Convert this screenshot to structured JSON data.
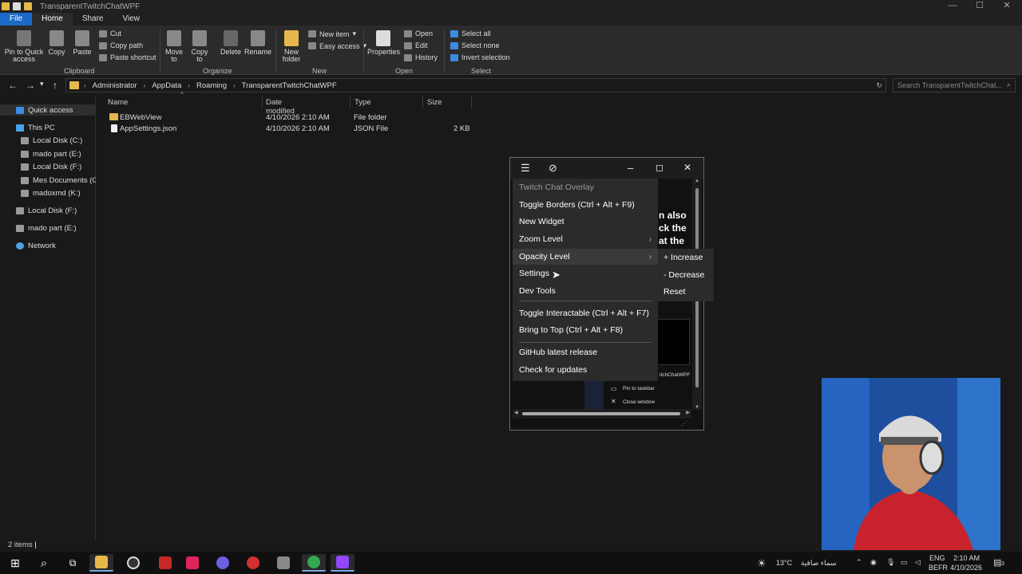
{
  "window": {
    "title": "TransparentTwitchChatWPF"
  },
  "ribbon": {
    "tabs": [
      "File",
      "Home",
      "Share",
      "View"
    ],
    "clipboard": {
      "pin": "Pin to Quick access",
      "copy": "Copy",
      "paste": "Paste",
      "cut": "Cut",
      "copy_path": "Copy path",
      "paste_shortcut": "Paste shortcut",
      "label": "Clipboard"
    },
    "organize": {
      "move_to": "Move to",
      "copy_to": "Copy to",
      "delete": "Delete",
      "rename": "Rename",
      "label": "Organize"
    },
    "new": {
      "new_folder": "New folder",
      "new_item": "New item",
      "easy_access": "Easy access",
      "label": "New"
    },
    "open": {
      "properties": "Properties",
      "open": "Open",
      "edit": "Edit",
      "history": "History",
      "label": "Open"
    },
    "select": {
      "select_all": "Select all",
      "select_none": "Select none",
      "invert": "Invert selection",
      "label": "Select"
    }
  },
  "address": {
    "crumbs": [
      "Administrator",
      "AppData",
      "Roaming",
      "TransparentTwitchChatWPF"
    ],
    "search_placeholder": "Search TransparentTwitchChat..."
  },
  "sidebar": {
    "items": [
      {
        "label": "Quick access",
        "icon": "star-icon"
      },
      {
        "label": "This PC",
        "icon": "pc-icon"
      },
      {
        "label": "Local Disk (C:)",
        "icon": "disk-icon"
      },
      {
        "label": "mado part (E:)",
        "icon": "disk-icon"
      },
      {
        "label": "Local Disk (F:)",
        "icon": "disk-icon"
      },
      {
        "label": "Mes Documents (G:",
        "icon": "disk-icon"
      },
      {
        "label": "madoxmd (K:)",
        "icon": "disk-icon"
      },
      {
        "label": "Local Disk (F:)",
        "icon": "disk-icon"
      },
      {
        "label": "mado part (E:)",
        "icon": "disk-icon"
      },
      {
        "label": "Network",
        "icon": "network-icon"
      }
    ]
  },
  "files": {
    "headers": [
      "Name",
      "Date modified",
      "Type",
      "Size"
    ],
    "rows": [
      {
        "name": "EBWebView",
        "date": "4/10/2026 2:10 AM",
        "type": "File folder",
        "size": ""
      },
      {
        "name": "AppSettings.json",
        "date": "4/10/2026 2:10 AM",
        "type": "JSON File",
        "size": "2 KB"
      }
    ]
  },
  "status": {
    "items": "2 items"
  },
  "overlay": {
    "menu": {
      "header": "Twitch Chat Overlay",
      "toggle_borders": "Toggle Borders (Ctrl + Alt + F9)",
      "new_widget": "New Widget",
      "zoom_level": "Zoom Level",
      "opacity_level": "Opacity Level",
      "settings": "Settings",
      "dev_tools": "Dev Tools",
      "toggle_interactable": "Toggle Interactable (Ctrl + Alt + F7)",
      "bring_to_top": "Bring to Top (Ctrl + Alt + F8)",
      "github": "GitHub latest release",
      "check_updates": "Check for updates"
    },
    "submenu": {
      "increase": "+ Increase",
      "decrease": "- Decrease",
      "reset": "Reset"
    },
    "chat_fragment": [
      "n also",
      "ck the",
      "at the"
    ],
    "chat_user": "itchChatWPF",
    "taskbar_ctx": {
      "pin": "Pin to taskbar",
      "close": "Close window"
    }
  },
  "tray": {
    "weather": "13°C",
    "weather_text": "سماء صافية",
    "lang": "ENG",
    "layout": "BEFR",
    "time": "2:10 AM",
    "date": "4/10/2026",
    "notif_count": "3"
  }
}
